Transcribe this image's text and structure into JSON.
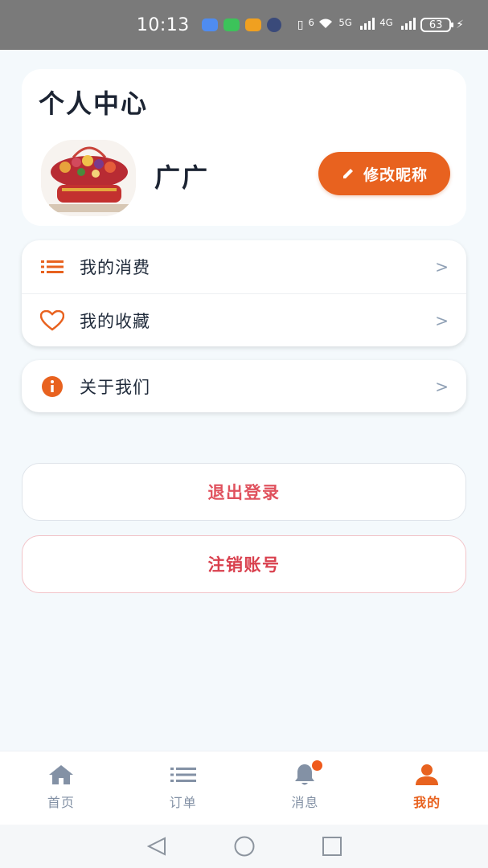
{
  "status_bar": {
    "time": "10:13",
    "network_5g": "5G",
    "network_4g": "4G",
    "wifi_label": "6",
    "battery": "63"
  },
  "profile": {
    "title": "个人中心",
    "nickname": "广广",
    "edit_button": "修改昵称"
  },
  "menu": {
    "group1": [
      {
        "label": "我的消费",
        "arrow": ">",
        "icon": "list-icon"
      },
      {
        "label": "我的收藏",
        "arrow": ">",
        "icon": "heart-icon"
      }
    ],
    "group2": [
      {
        "label": "关于我们",
        "arrow": ">",
        "icon": "info-icon"
      }
    ]
  },
  "actions": {
    "logout": "退出登录",
    "delete_account": "注销账号"
  },
  "tabs": [
    {
      "label": "首页",
      "icon": "home-icon",
      "active": false
    },
    {
      "label": "订单",
      "icon": "list-icon",
      "active": false
    },
    {
      "label": "消息",
      "icon": "bell-icon",
      "active": false,
      "has_dot": true
    },
    {
      "label": "我的",
      "icon": "user-icon",
      "active": true
    }
  ],
  "colors": {
    "accent": "#e8621f",
    "danger": "#e0525e",
    "tab_inactive": "#8391a5",
    "background": "#f4f9fc"
  }
}
